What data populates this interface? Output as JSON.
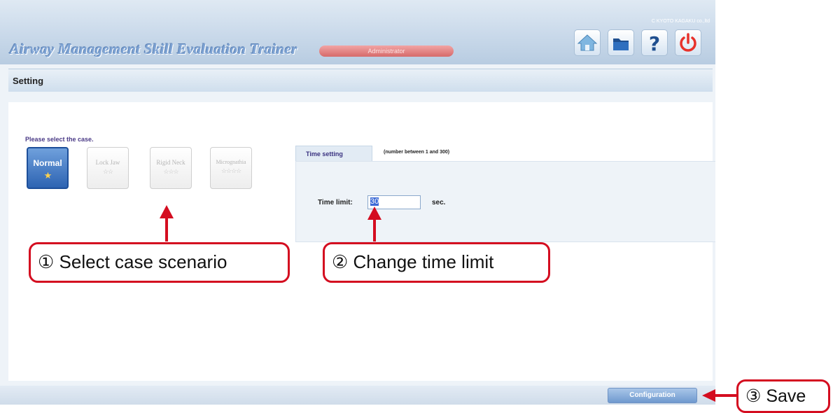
{
  "header": {
    "app_title": "Airway Management Skill Evaluation Trainer",
    "role_badge": "Administrator",
    "copyright": "C KYOTO KAGAKU co.,ltd",
    "icons": [
      "home-icon",
      "folder-icon",
      "help-icon",
      "power-icon"
    ]
  },
  "section": {
    "title": "Setting"
  },
  "case_select": {
    "prompt": "Please select the case.",
    "cases": [
      {
        "label": "Normal",
        "stars": "★",
        "selected": true
      },
      {
        "label": "Lock Jaw",
        "stars": "☆☆",
        "selected": false
      },
      {
        "label": "Rigid Neck",
        "stars": "☆☆☆",
        "selected": false
      },
      {
        "label": "Micrognathia",
        "stars": "☆☆☆☆",
        "selected": false
      }
    ]
  },
  "time_setting": {
    "tab_label": "Time setting",
    "hint": "(number between 1 and 300)",
    "field_label": "Time limit:",
    "value": "30",
    "unit": "sec."
  },
  "footer": {
    "config_button": "Configuration"
  },
  "callouts": {
    "step1": "① Select case scenario",
    "step2": "② Change time limit",
    "step3": "③ Save"
  },
  "colors": {
    "accent_red": "#d40d20",
    "selected_case": "#2d63b2",
    "power_icon": "#e8322b"
  }
}
